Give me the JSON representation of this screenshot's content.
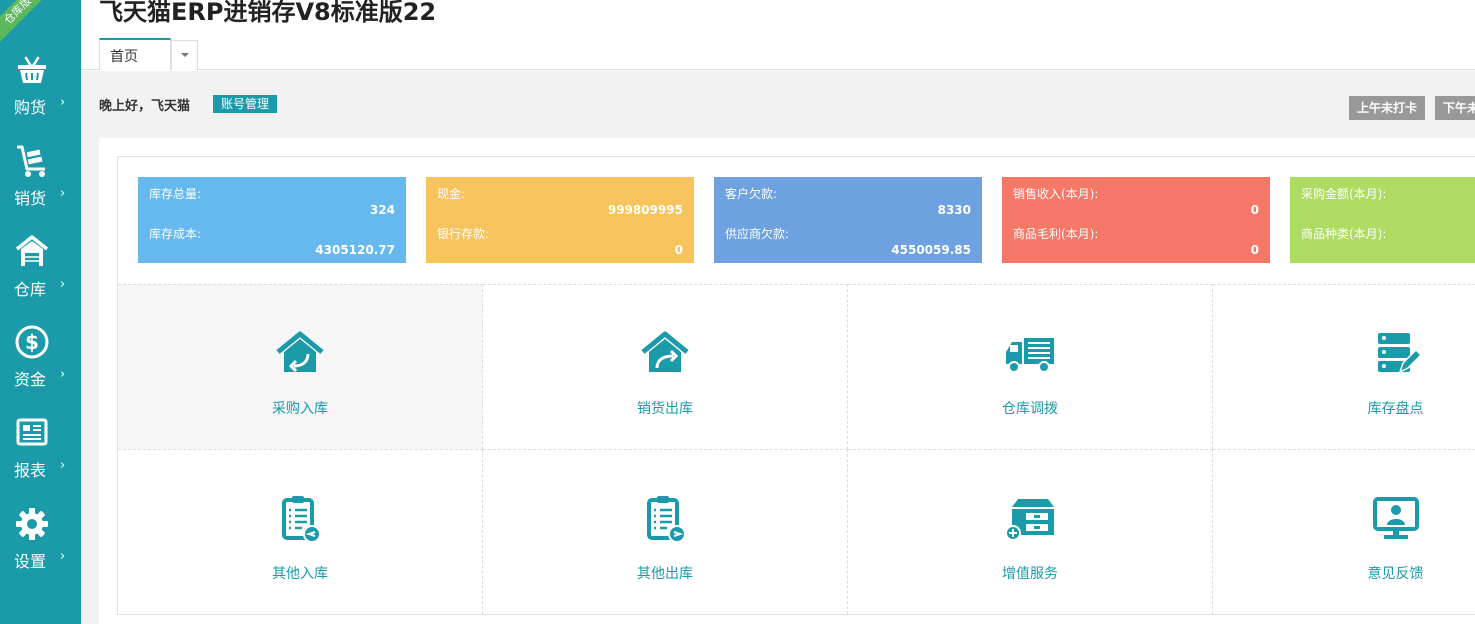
{
  "app": {
    "title": "飞天猫ERP进销存V8标准版22",
    "ribbon": "仓库版"
  },
  "sidebar": {
    "items": [
      {
        "label": "购货",
        "icon": "basket-icon"
      },
      {
        "label": "销货",
        "icon": "cart-icon"
      },
      {
        "label": "仓库",
        "icon": "warehouse-icon"
      },
      {
        "label": "资金",
        "icon": "dollar-icon"
      },
      {
        "label": "报表",
        "icon": "report-icon"
      },
      {
        "label": "设置",
        "icon": "gear-icon"
      }
    ],
    "arrow": "›"
  },
  "tabs": {
    "home": "首页"
  },
  "header": {
    "greeting": "晚上好，飞天猫",
    "account_button": "账号管理",
    "clock_am": "上午未打卡",
    "clock_pm": "下午未打卡"
  },
  "stats": [
    {
      "label1": "库存总量:",
      "value1": "324",
      "label2": "库存成本:",
      "value2": "4305120.77",
      "color": "#65b9ee"
    },
    {
      "label1": "现金:",
      "value1": "999809995",
      "label2": "银行存款:",
      "value2": "0",
      "color": "#f6c35c"
    },
    {
      "label1": "客户欠款:",
      "value1": "8330",
      "label2": "供应商欠款:",
      "value2": "4550059.85",
      "color": "#6ea1e0"
    },
    {
      "label1": "销售收入(本月):",
      "value1": "0",
      "label2": "商品毛利(本月):",
      "value2": "0",
      "color": "#f67868"
    },
    {
      "label1": "采购金额(本月):",
      "value1": "",
      "label2": "商品种类(本月):",
      "value2": "",
      "color": "#aedc62"
    }
  ],
  "quick": [
    {
      "label": "采购入库",
      "icon": "purchase-in-icon"
    },
    {
      "label": "销货出库",
      "icon": "sales-out-icon"
    },
    {
      "label": "仓库调拨",
      "icon": "truck-transfer-icon"
    },
    {
      "label": "库存盘点",
      "icon": "inventory-check-icon"
    },
    {
      "label": "其他入库",
      "icon": "other-in-icon"
    },
    {
      "label": "其他出库",
      "icon": "other-out-icon"
    },
    {
      "label": "增值服务",
      "icon": "value-service-icon"
    },
    {
      "label": "意见反馈",
      "icon": "feedback-icon"
    }
  ],
  "colors": {
    "accent": "#1b9aaa",
    "ribbon": "#5cb85c",
    "clock_button": "#999999"
  }
}
